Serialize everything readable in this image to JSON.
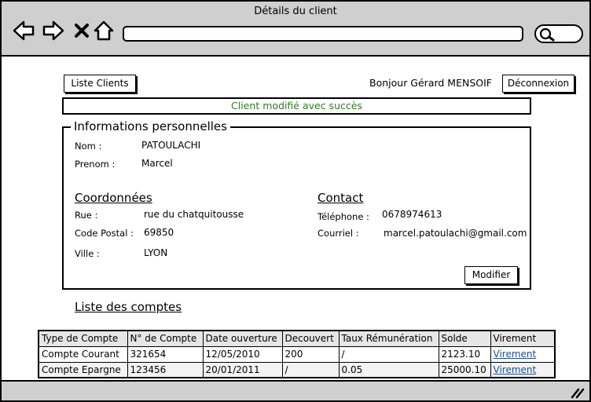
{
  "window": {
    "title": "Détails du client"
  },
  "header": {
    "clients_list_label": "Liste Clients",
    "greeting": "Bonjour Gérard MENSOIF",
    "logout_label": "Déconnexion"
  },
  "notice": "Client modifié avec succès",
  "personal": {
    "legend": "Informations personnelles",
    "nom_label": "Nom :",
    "nom": "PATOULACHI",
    "prenom_label": "Prenom :",
    "prenom": "Marcel"
  },
  "coords": {
    "title": "Coordonnées",
    "rue_label": "Rue :",
    "rue": "rue du chatquitousse",
    "cp_label": "Code Postal :",
    "cp": "69850",
    "ville_label": "Ville :",
    "ville": "LYON"
  },
  "contact": {
    "title": "Contact",
    "tel_label": "Téléphone :",
    "tel": "0678974613",
    "mail_label": "Courriel :",
    "mail": "marcel.patoulachi@gmail.com"
  },
  "modify_label": "Modifier",
  "accounts": {
    "title": "Liste des comptes",
    "headers": [
      "Type de Compte",
      "N° de Compte",
      "Date ouverture",
      "Decouvert",
      "Taux Rémunération",
      "Solde",
      "Virement"
    ],
    "rows": [
      [
        "Compte Courant",
        "321654",
        "12/05/2010",
        "200",
        "/",
        "2123.10",
        "Virement"
      ],
      [
        "Compte Epargne",
        "123456",
        "20/01/2011",
        "/",
        "0.05",
        "25000.10",
        "Virement"
      ]
    ]
  }
}
